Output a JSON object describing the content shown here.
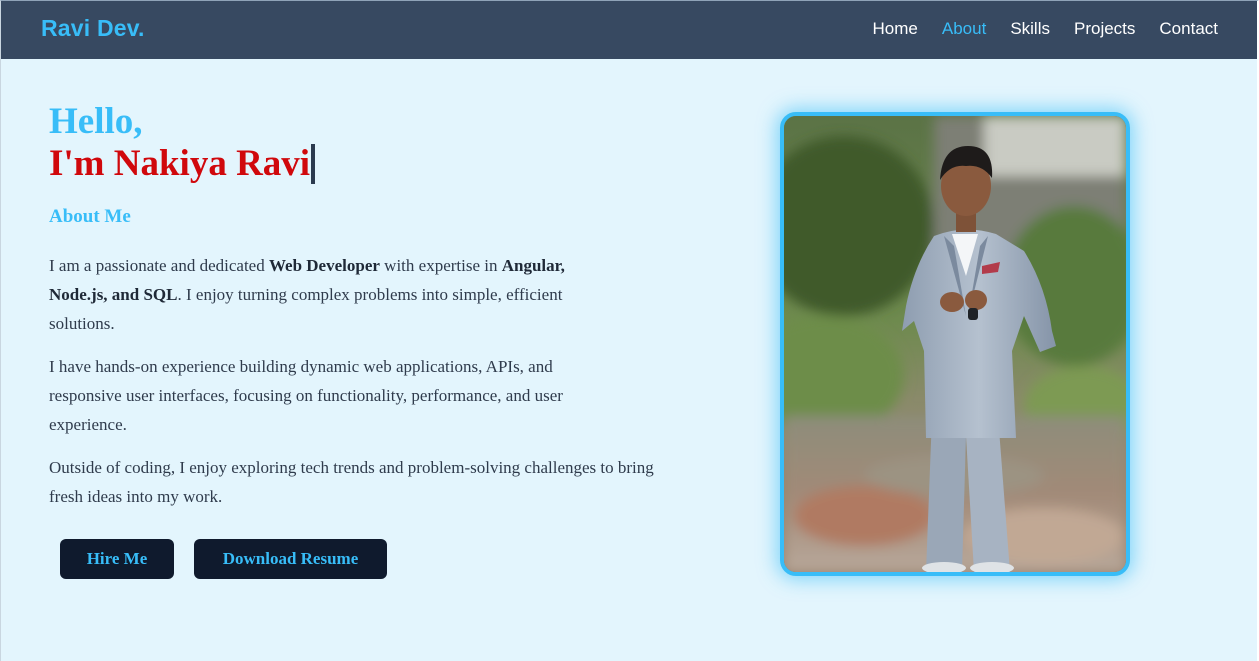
{
  "navbar": {
    "brand": "Ravi Dev.",
    "links": [
      {
        "label": "Home",
        "active": false
      },
      {
        "label": "About",
        "active": true
      },
      {
        "label": "Skills",
        "active": false
      },
      {
        "label": "Projects",
        "active": false
      },
      {
        "label": "Contact",
        "active": false
      }
    ]
  },
  "hero": {
    "greeting": "Hello,",
    "name": "I'm Nakiya Ravi",
    "about_heading": "About Me",
    "paragraph1": {
      "t1": "I am a passionate and dedicated ",
      "b1": "Web Developer",
      "t2": " with expertise in ",
      "b2": "Angular, Node.js, and SQL",
      "t3": ". I enjoy turning complex problems into simple, efficient solutions."
    },
    "paragraph2": "I have hands-on experience building dynamic web applications, APIs, and responsive user interfaces, focusing on functionality, performance, and user experience.",
    "paragraph3": "Outside of coding, I enjoy exploring tech trends and problem-solving challenges to bring fresh ideas into my work.",
    "buttons": {
      "hire": "Hire Me",
      "resume": "Download Resume"
    }
  },
  "colors": {
    "accent": "#38bdf8",
    "name_red": "#d0080c",
    "navbar_bg": "#374961",
    "page_bg": "#e3f5fd",
    "button_bg": "#0f1a2d"
  },
  "profile_photo": {
    "subject": "man-in-grey-suit-portrait"
  }
}
